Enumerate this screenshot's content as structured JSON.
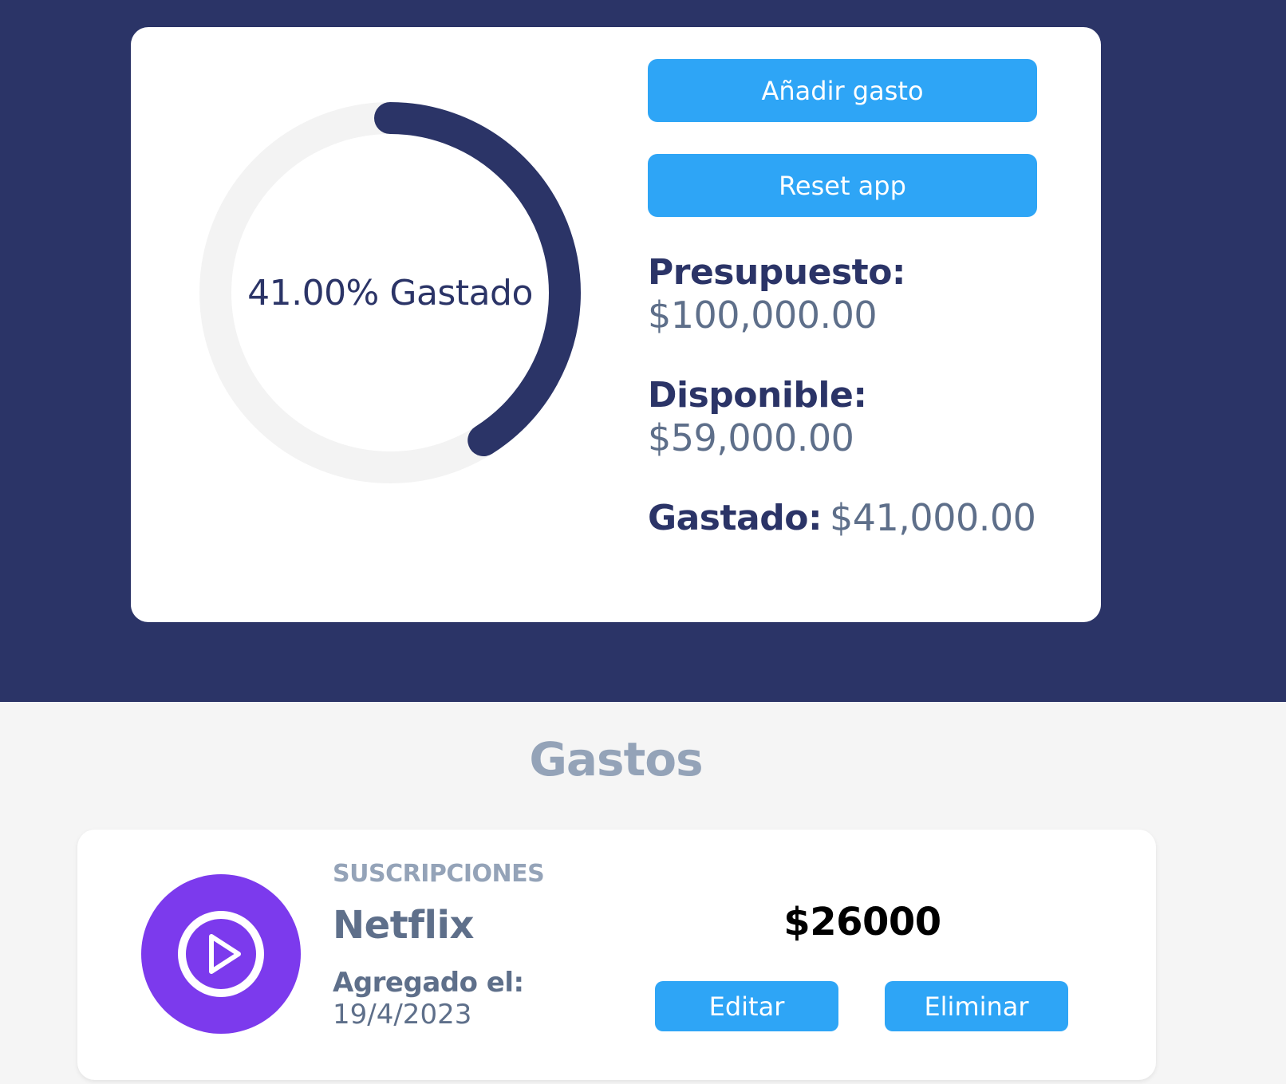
{
  "colors": {
    "header_bg": "#2b3467",
    "accent": "#2ea5f6",
    "ring_track": "#f3f3f3",
    "ring_progress": "#2b3467",
    "category_icon": "#7c3aed"
  },
  "budget": {
    "percent_spent": 41,
    "percent_label": "41.00% Gastado",
    "add_button": "Añadir gasto",
    "reset_button": "Reset app",
    "presupuesto_label": "Presupuesto:",
    "presupuesto_value": "$100,000.00",
    "disponible_label": "Disponible:",
    "disponible_value": "$59,000.00",
    "gastado_label": "Gastado:",
    "gastado_value": "$41,000.00"
  },
  "expenses": {
    "title": "Gastos",
    "items": [
      {
        "category": "SUSCRIPCIONES",
        "icon": "play-circle-icon",
        "name": "Netflix",
        "added_label": "Agregado el:",
        "date": "19/4/2023",
        "amount": "$26000",
        "edit_label": "Editar",
        "delete_label": "Eliminar"
      }
    ]
  }
}
